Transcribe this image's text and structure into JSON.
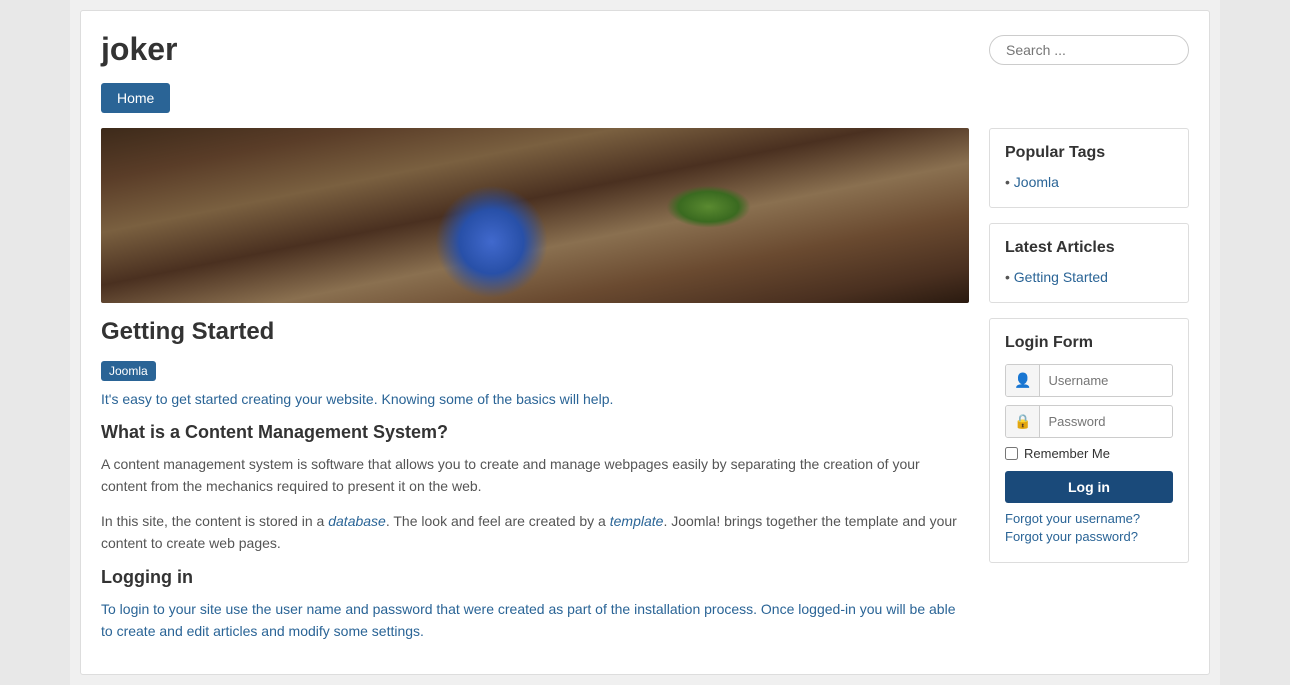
{
  "header": {
    "site_title": "joker",
    "search_placeholder": "Search ..."
  },
  "nav": {
    "home_label": "Home"
  },
  "main_article": {
    "title": "Getting Started",
    "tag": "Joomla",
    "intro": "It's easy to get started creating your website. Knowing some of the basics will help.",
    "section1_title": "What is a Content Management System?",
    "section1_para1": "A content management system is software that allows you to create and manage webpages easily by separating the creation of your content from the mechanics required to present it on the web.",
    "section1_para2_part1": "In this site, the content is stored in a ",
    "section1_em1": "database",
    "section1_para2_part2": ". The look and feel are created by a ",
    "section1_em2": "template",
    "section1_para2_part3": ". Joomla! brings together the template and your content to create web pages.",
    "section2_title": "Logging in",
    "section2_para1": "To login to your site use the user name and password that were created as part of the installation process. Once logged-in you will be able to create and edit articles and modify some settings."
  },
  "sidebar": {
    "popular_tags": {
      "title": "Popular Tags",
      "items": [
        {
          "label": "Joomla",
          "href": "#"
        }
      ]
    },
    "latest_articles": {
      "title": "Latest Articles",
      "items": [
        {
          "label": "Getting Started",
          "href": "#"
        }
      ]
    },
    "login_form": {
      "title": "Login Form",
      "username_placeholder": "Username",
      "password_placeholder": "Password",
      "remember_label": "Remember Me",
      "login_button": "Log in",
      "forgot_username": "Forgot your username?",
      "forgot_password": "Forgot your password?"
    }
  }
}
